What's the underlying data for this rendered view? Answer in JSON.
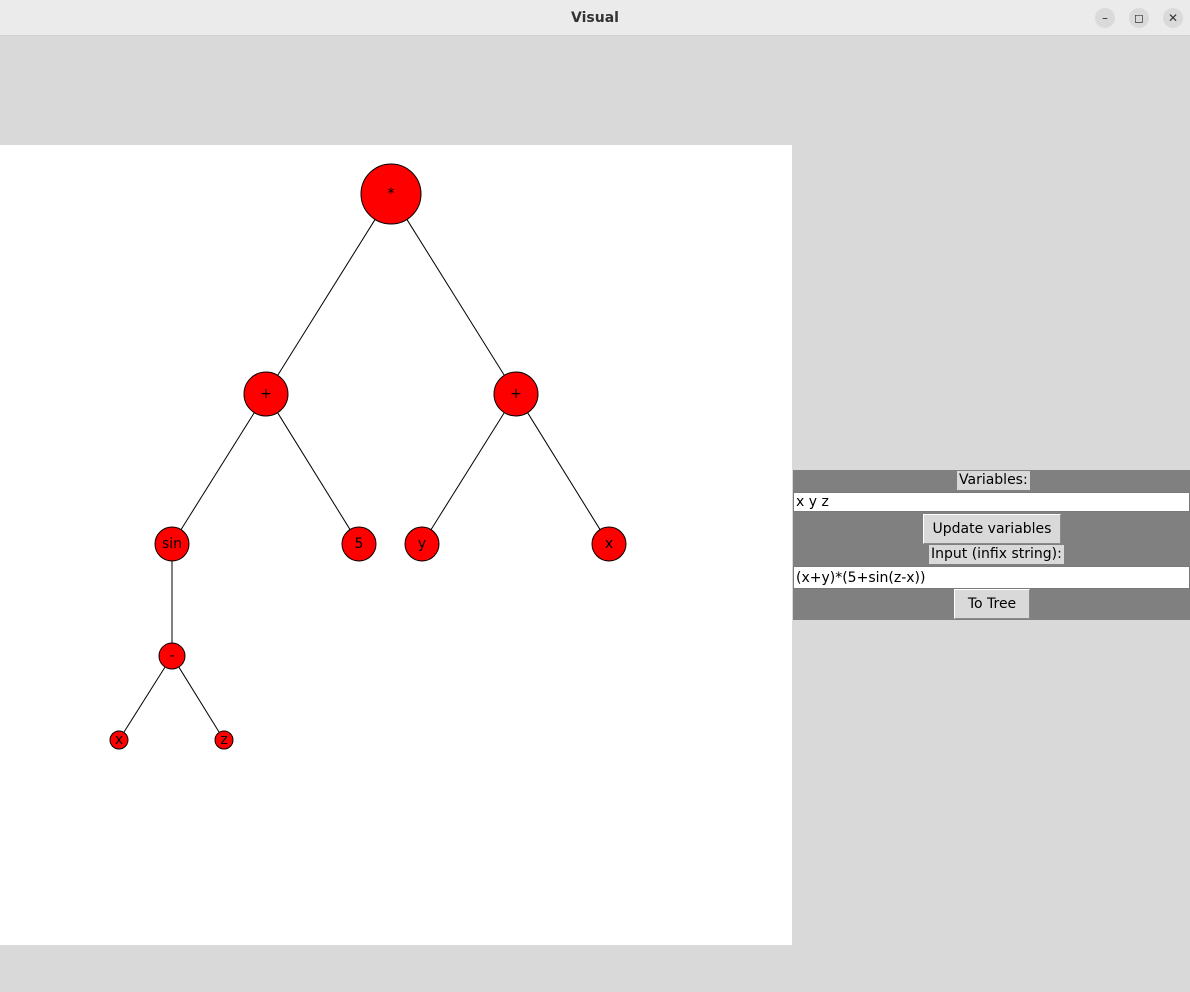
{
  "window": {
    "title": "Visual",
    "controls": {
      "minimize": "–",
      "maximize": "◻",
      "close": "✕"
    }
  },
  "tree": {
    "node_color": "#ff0000",
    "nodes": [
      {
        "id": "n0",
        "label": "*"
      },
      {
        "id": "n1",
        "label": "+"
      },
      {
        "id": "n2",
        "label": "+"
      },
      {
        "id": "n3",
        "label": "sin"
      },
      {
        "id": "n4",
        "label": "5"
      },
      {
        "id": "n5",
        "label": "y"
      },
      {
        "id": "n6",
        "label": "x"
      },
      {
        "id": "n7",
        "label": "-"
      },
      {
        "id": "n8",
        "label": "x"
      },
      {
        "id": "n9",
        "label": "z"
      }
    ],
    "edges": [
      [
        "n0",
        "n1"
      ],
      [
        "n0",
        "n2"
      ],
      [
        "n1",
        "n3"
      ],
      [
        "n1",
        "n4"
      ],
      [
        "n2",
        "n5"
      ],
      [
        "n2",
        "n6"
      ],
      [
        "n3",
        "n7"
      ],
      [
        "n7",
        "n8"
      ],
      [
        "n7",
        "n9"
      ]
    ]
  },
  "controls": {
    "variables_label": "Variables:",
    "variables_value": "x y z",
    "update_button": "Update variables",
    "input_label": "Input (infix string):",
    "input_value": "(x+y)*(5+sin(z-x))",
    "to_tree_button": "To Tree"
  }
}
